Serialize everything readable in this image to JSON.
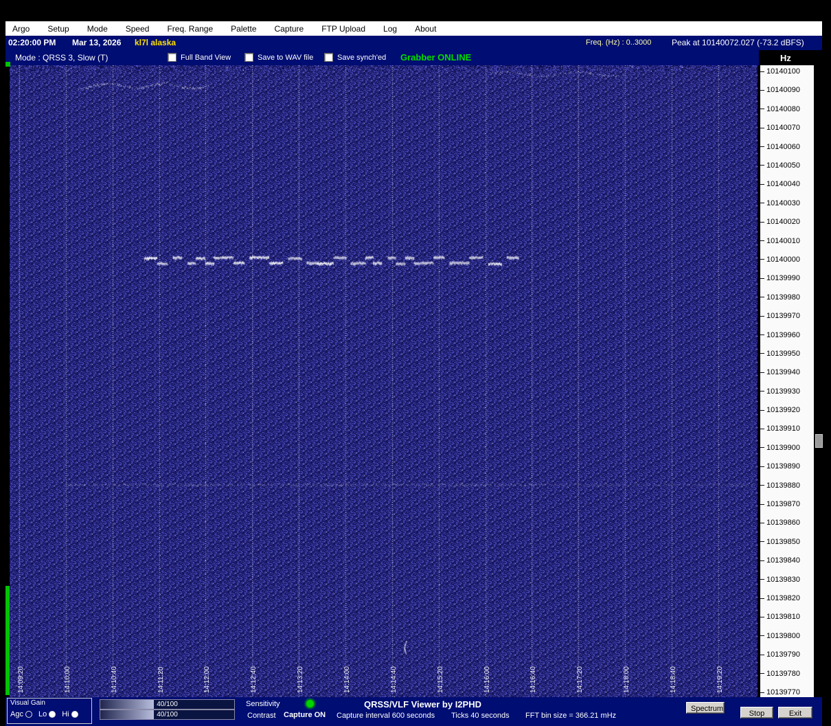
{
  "menu": {
    "items": [
      "Argo",
      "Setup",
      "Mode",
      "Speed",
      "Freq. Range",
      "Palette",
      "Capture",
      "FTP Upload",
      "Log",
      "About"
    ]
  },
  "title_bar": {
    "time": "02:20:00 PM",
    "date": "Mar 13, 2026",
    "callsign": "kl7l alaska",
    "freq_range_label": "Freq. (Hz) :  0..3000",
    "peak_label": "Peak at 10140072.027 (-73.2 dBFS)"
  },
  "mode_bar": {
    "mode_label": "Mode : QRSS 3, Slow (T)",
    "checkboxes": [
      {
        "label": "Full Band View",
        "checked": false
      },
      {
        "label": "Save to WAV file",
        "checked": false
      },
      {
        "label": "Save synch'ed",
        "checked": false
      }
    ],
    "grabber_status": "Grabber ONLINE",
    "hz_unit": "Hz"
  },
  "waterfall": {
    "time_labels": [
      "14:09:20",
      "14:10:00",
      "14:10:40",
      "14:11:20",
      "14:12:00",
      "14:12:40",
      "14:13:20",
      "14:14:00",
      "14:14:40",
      "14:15:20",
      "14:16:00",
      "14:16:40",
      "14:17:20",
      "14:18:00",
      "14:18:40",
      "14:19:20"
    ],
    "freq_labels": [
      "10140100",
      "10140090",
      "10140080",
      "10140070",
      "10140060",
      "10140050",
      "10140040",
      "10140030",
      "10140020",
      "10140010",
      "10140000",
      "10139990",
      "10139980",
      "10139970",
      "10139960",
      "10139950",
      "10139940",
      "10139930",
      "10139920",
      "10139910",
      "10139900",
      "10139890",
      "10139880",
      "10139870",
      "10139860",
      "10139850",
      "10139840",
      "10139830",
      "10139820",
      "10139810",
      "10139800",
      "10139790",
      "10139780",
      "10139770"
    ]
  },
  "status_bar": {
    "visual_gain": {
      "title": "Visual Gain",
      "options": [
        {
          "label": "Agc",
          "selected": false
        },
        {
          "label": "Lo",
          "selected": true
        },
        {
          "label": "Hi",
          "selected": true
        }
      ]
    },
    "sensitivity": {
      "label": "Sensitivity",
      "value": "40/100",
      "percent": 40
    },
    "contrast": {
      "label": "Contrast",
      "value": "40/100",
      "percent": 40
    },
    "capture_status": "Capture ON",
    "capture_interval": "Capture interval 600 seconds",
    "app_title": "QRSS/VLF Viewer by I2PHD",
    "ticks_info": "Ticks  40 seconds",
    "fft_info": "FFT bin size = 366.21 mHz",
    "buttons": {
      "spectrum": "Spectrum",
      "stop": "Stop",
      "exit": "Exit"
    }
  },
  "colors": {
    "title_bar_bg": "#000d72",
    "status_green": "#00d400",
    "callsign_yellow": "#ffe000",
    "grabber_green": "#00dd00",
    "waterfall_base": "#26268e"
  }
}
